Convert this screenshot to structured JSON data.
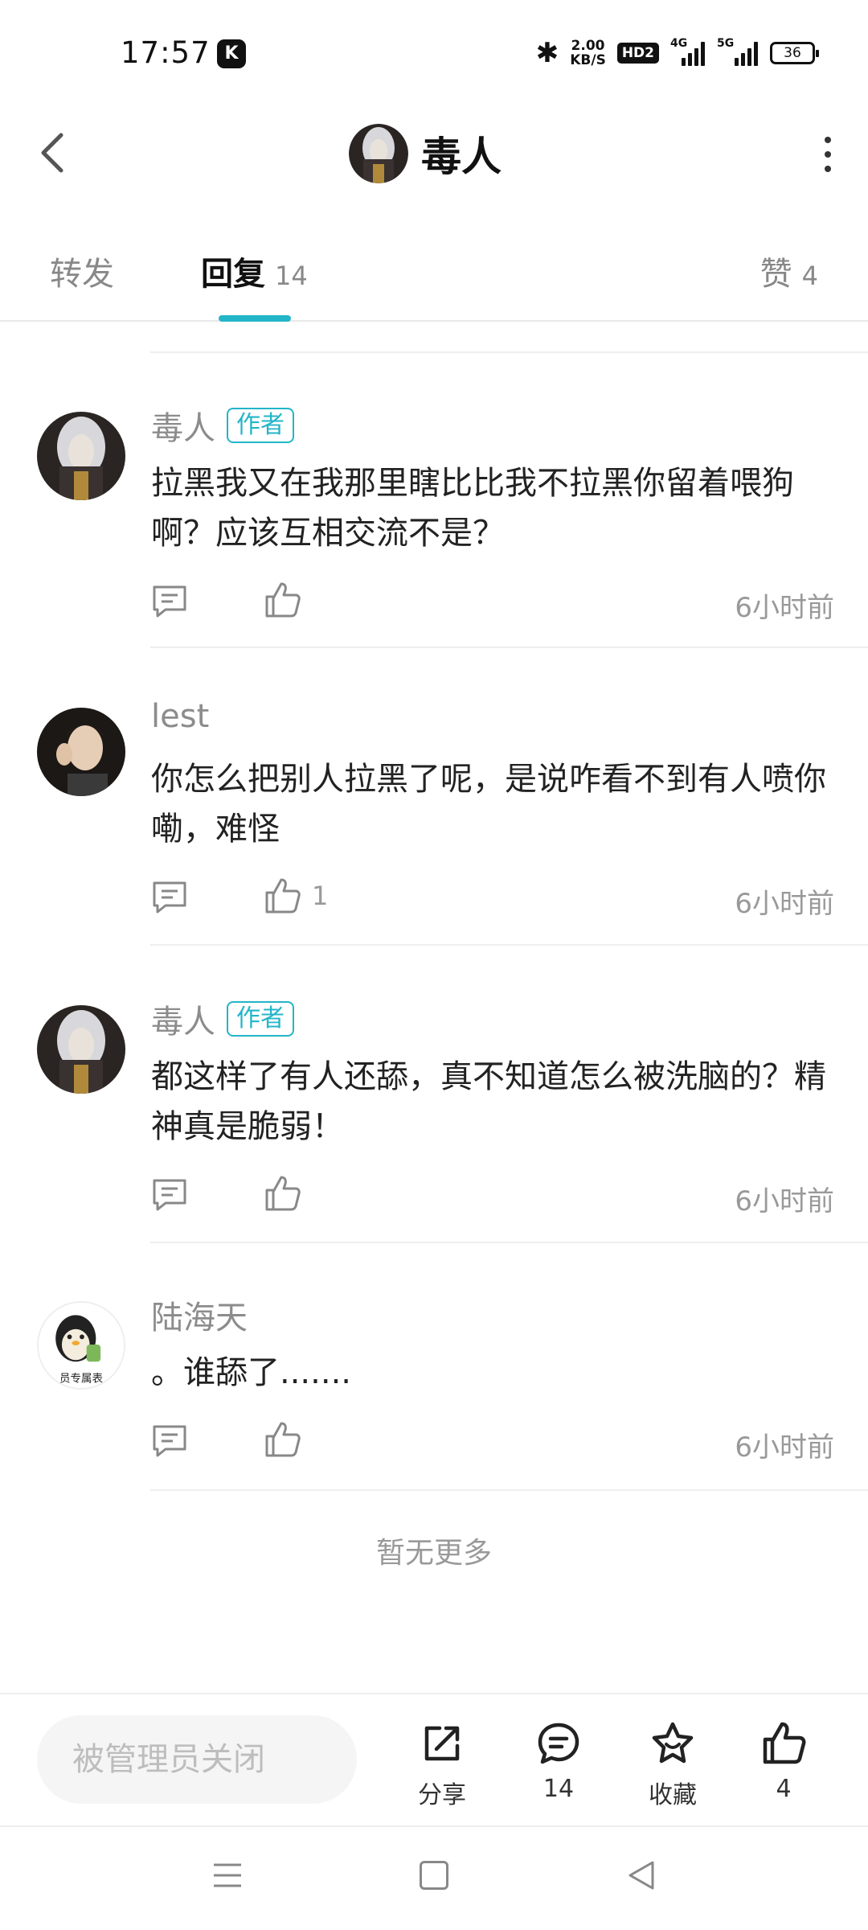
{
  "status_bar": {
    "time": "17:57",
    "app_icon": "K",
    "bluetooth": "✱",
    "speed_value": "2.00",
    "speed_unit": "KB/S",
    "hd": "HD2",
    "net1": "4G",
    "net2": "5G",
    "battery": "36"
  },
  "header": {
    "title": "毒人",
    "back_icon": "chevron-left-icon",
    "more_icon": "more-vertical-icon"
  },
  "tabs": {
    "forward": "转发",
    "reply": "回复",
    "reply_count": "14",
    "like": "赞",
    "like_count": "4"
  },
  "comments": [
    {
      "name": "毒人",
      "author_badge": "作者",
      "text": "拉黑我又在我那里瞎比比我不拉黑你留着喂狗啊？应该互相交流不是？",
      "like_count": "",
      "time": "6小时前"
    },
    {
      "name": "lest",
      "author_badge": "",
      "text": "你怎么把别人拉黑了呢，是说咋看不到有人喷你嘞，难怪",
      "like_count": "1",
      "time": "6小时前"
    },
    {
      "name": "毒人",
      "author_badge": "作者",
      "text": "都这样了有人还舔，真不知道怎么被洗脑的？精神真是脆弱！",
      "like_count": "",
      "time": "6小时前"
    },
    {
      "name": "陆海天",
      "author_badge": "",
      "text": "。谁舔了.......",
      "like_count": "",
      "time": "6小时前"
    }
  ],
  "no_more": "暂无更多",
  "avatar_caption": "员专属表",
  "bottom_bar": {
    "input_placeholder": "被管理员关闭",
    "share": "分享",
    "comments": "14",
    "favorite": "收藏",
    "like": "4"
  },
  "colors": {
    "accent": "#23b5c8",
    "text_primary": "#222222",
    "text_secondary": "#8c8c8c"
  }
}
